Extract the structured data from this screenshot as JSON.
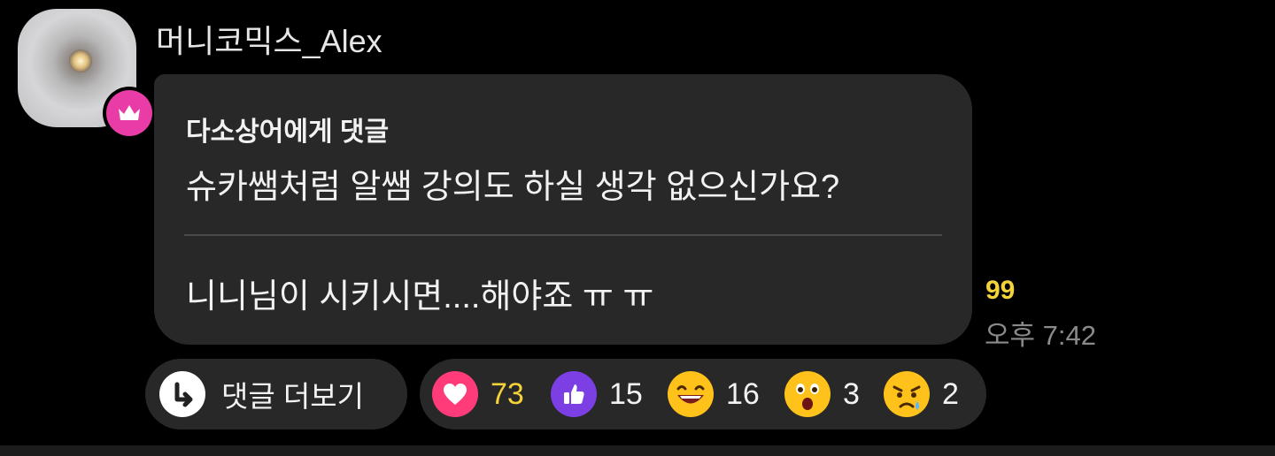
{
  "comment": {
    "username": "머니코믹스_Alex",
    "badge_icon": "crown-icon",
    "reply_to": "다소상어에게 댓글",
    "quoted_text": "슈카쌤처럼 알쌤 강의도 하실 생각 없으신가요?",
    "reply_text": "니니님이 시키시면....해야죠 ㅠ ㅠ",
    "read_count": "99",
    "time": "오후 7:42"
  },
  "actions": {
    "more_replies_label": "댓글 더보기",
    "more_replies_icon": "reply-arrow-icon"
  },
  "reactions": [
    {
      "name": "heart",
      "icon": "heart-icon",
      "count": "73",
      "color": "#ff3b7a",
      "count_color": "#f3d23a"
    },
    {
      "name": "like",
      "icon": "thumbs-up-icon",
      "count": "15",
      "color": "#7b3fe4",
      "count_color": "#f2f2f2"
    },
    {
      "name": "laugh",
      "icon": "laughing-face-icon",
      "count": "16",
      "color": "#ffc21a",
      "count_color": "#f2f2f2"
    },
    {
      "name": "surprise",
      "icon": "surprised-face-icon",
      "count": "3",
      "color": "#ffc21a",
      "count_color": "#f2f2f2"
    },
    {
      "name": "sad",
      "icon": "sad-face-icon",
      "count": "2",
      "color": "#ffc21a",
      "count_color": "#f2f2f2"
    }
  ],
  "colors": {
    "background": "#000000",
    "bubble": "#282828",
    "accent_pink": "#e93ca7",
    "highlight_yellow": "#f3d23a"
  }
}
